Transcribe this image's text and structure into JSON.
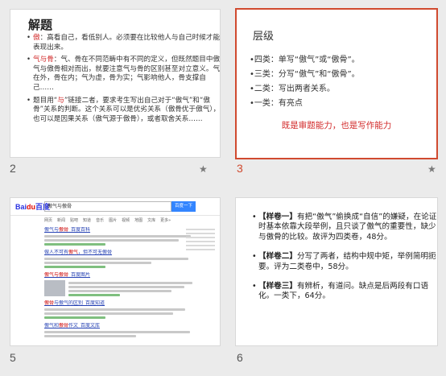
{
  "slides": [
    {
      "number": "2",
      "title": "解题",
      "items": [
        {
          "lead": "傲",
          "text": "：高看自己，看低别人。必须要在比较他人与自己时候才能表现出来。"
        },
        {
          "lead": "气与骨",
          "text": "：气、骨在不同范畴中有不同的定义，但既然题目中傲气与傲骨相对而出，就要注意气与骨的区别甚至对立意义。气在外，骨在内；气为虚，骨为实；气影响他人，骨支撑自己……"
        },
        {
          "pre": "题目用“",
          "highlight": "与",
          "text": "”链接二者，要求考生写出自己对于“傲气”和“傲骨”关系的判断。这个关系可以是优劣关系（傲骨优于傲气），也可以是因果关系（傲气源于傲骨），或者取舍关系……"
        }
      ]
    },
    {
      "number": "3",
      "title": "层级",
      "items": [
        "•四类：单写“傲气”或“傲骨”。",
        "•三类：分写“傲气”和“傲骨”。",
        "•二类：写出两者关系。",
        "•一类：有亮点"
      ],
      "footer": "既是审题能力，也是写作能力"
    },
    {
      "number": "5",
      "search": {
        "logo_a": "Bai",
        "logo_paw": "du",
        "logo_b": "百度",
        "query": "傲气与傲骨",
        "button": "百度一下",
        "tabs": [
          "网页",
          "新闻",
          "贴吧",
          "知道",
          "音乐",
          "图片",
          "视频",
          "地图",
          "文库",
          "更多»"
        ],
        "results": [
          {
            "title_a": "傲气与",
            "title_em": "傲骨",
            "title_b": "_百度百科"
          },
          {
            "title_a": "做人不可有",
            "title_em": "傲气",
            "title_b": "，但不可无傲骨"
          },
          {
            "title_a": "",
            "title_em": "傲气与傲骨",
            "title_b": "_百度图片"
          },
          {
            "title_a": "",
            "title_em": "傲骨",
            "title_b": "与傲气的区别_百度知道"
          },
          {
            "title_a": "傲气和",
            "title_em": "傲骨",
            "title_b": "作文_百度文库"
          }
        ]
      }
    },
    {
      "number": "6",
      "items": [
        {
          "tag": "【样卷一】",
          "text": "有把“傲气”偷换成“自信”的嫌疑，在论证时基本依靠大段举例，且只谈了傲气的重要性，缺少与傲骨的比较。故评为四类卷，48分。"
        },
        {
          "tag": "【样卷二】",
          "text": "分写了两者，结构中规中矩，举例简明扼要。评为二类卷中，58分。"
        },
        {
          "tag": "【样卷三】",
          "text": "有辨析，有道问。缺点是后两段有口语化。一类下，64分。"
        }
      ]
    }
  ],
  "star_glyph": "★",
  "bullet_glyph": "•",
  "colors": {
    "selected": "#d04a2f",
    "emphasis": "#d22b2b",
    "link": "#2440b3"
  }
}
